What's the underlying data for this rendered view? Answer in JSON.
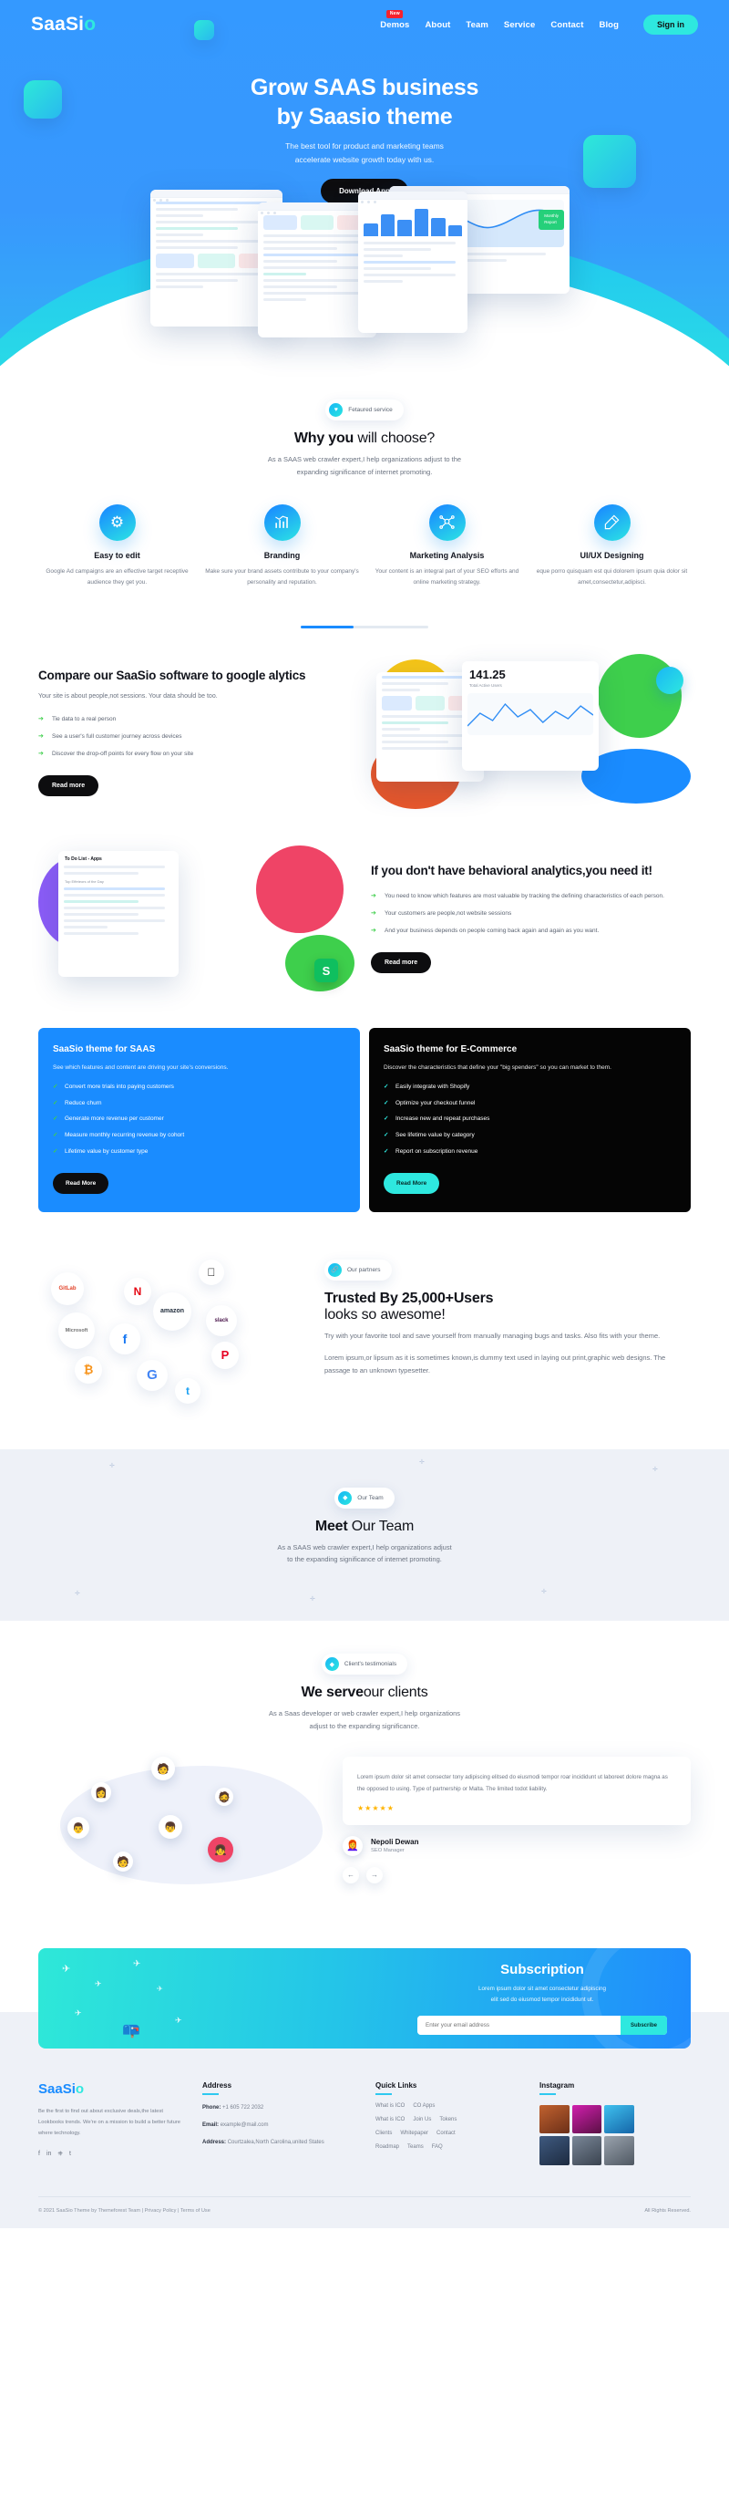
{
  "brand": {
    "name_main": "SaaSi",
    "name_accent": "o"
  },
  "nav": {
    "items": [
      {
        "label": "Demos",
        "badge": "New"
      },
      {
        "label": "About",
        "badge": ""
      },
      {
        "label": "Team",
        "badge": ""
      },
      {
        "label": "Service",
        "badge": ""
      },
      {
        "label": "Contact",
        "badge": ""
      },
      {
        "label": "Blog",
        "badge": ""
      }
    ],
    "signin_label": "Sign in"
  },
  "hero": {
    "title_line1": "Grow SAAS business",
    "title_line2": "by Saasio theme",
    "sub_line1": "The best tool for product and marketing teams",
    "sub_line2": "accelerate website growth today with us.",
    "cta_label": "Download App"
  },
  "why": {
    "pill_icon": "heart-icon",
    "pill_label": "Fetaured service",
    "title_bold": "Why you",
    "title_rest": " will choose?",
    "sub_line1": "As a SAAS web crawler expert,I help organizations adjust to the",
    "sub_line2": "expanding significance of internet promoting.",
    "features": [
      {
        "icon": "gear-icon",
        "glyph": "⚙",
        "title": "Easy to edit",
        "desc": "Google Ad campaigns are an effective target receptive audience they get you."
      },
      {
        "icon": "bar-chart-icon",
        "glyph": "📊",
        "title": "Branding",
        "desc": "Make sure your brand assets contribute to your company's personality and reputation."
      },
      {
        "icon": "network-user-icon",
        "glyph": "🕸",
        "title": "Marketing Analysis",
        "desc": "Your content is an integral part of your SEO efforts and online marketing strategy."
      },
      {
        "icon": "pencil-ruler-icon",
        "glyph": "✎",
        "title": "UI/UX Designing",
        "desc": "eque porro quisquam est qui dolorem ipsum quia dolor sit amet,consectetur,adipisci."
      }
    ]
  },
  "compare": {
    "title": "Compare our SaaSio software to google alytics",
    "lead": "Your site is about people,not sessions. Your data should be too.",
    "bullets": [
      "Tie data to a real person",
      "See a user's full customer journey across devices",
      "Discover the drop-off points for every flow on your site"
    ],
    "cta_label": "Read more",
    "stat_value": "141.25",
    "stat_caption": "Total Active Users"
  },
  "behavioral": {
    "title": "If you don't have behavioral analytics,you need it!",
    "bullets": [
      "You need to know which features are most valuable by tracking the defining characteristics of each person.",
      "Your customers are people,not website sessions",
      "And your business depends on people coming back again and again as you want."
    ],
    "cta_label": "Read more",
    "todo_title": "To Do List - Apps",
    "todo_sub": "Top Effeteors of the Day"
  },
  "panels": [
    {
      "variant": "blue",
      "title": "SaaSio theme for SAAS",
      "desc": "See which features and content are driving your site's conversions.",
      "items": [
        "Convert more trials into paying customers",
        "Reduce churn",
        "Generate more revenue per customer",
        "Measure monthly recurring revenue by cohort",
        "Lifetime value by customer type"
      ],
      "cta_label": "Read More"
    },
    {
      "variant": "black",
      "title": "SaaSio theme for E-Commerce",
      "desc": "Discover the characteristics that define your \"big spenders\" so you can market to them.",
      "items": [
        "Easily integrate with Shopify",
        "Optimize your checkout funnel",
        "Increase new and repeat purchases",
        "See lifetime value by category",
        "Report on subscription revenue"
      ],
      "cta_label": "Read More"
    }
  ],
  "partners": {
    "pill_icon": "link-icon",
    "pill_label": "Our partners",
    "title_bold": "Trusted By 25,000+Users",
    "title_rest": "looks so awesome!",
    "para1": "Try with your favorite tool and save yourself from manually managing bugs and tasks. Also fits with your theme.",
    "para2": "Lorem ipsum,or lipsum as it is sometimes known,is dummy text used in laying out print,graphic web designs. The passage to an unknown typesetter.",
    "logos": [
      {
        "name": "Gitlab",
        "text": "GitLab",
        "color": "#e2432a"
      },
      {
        "name": "Apple",
        "text": "",
        "color": "#111111"
      },
      {
        "name": "Netflix",
        "text": "N",
        "color": "#e50914"
      },
      {
        "name": "Amazon",
        "text": "amazon",
        "color": "#232f3e"
      },
      {
        "name": "Slack",
        "text": "slack",
        "color": "#4a154b"
      },
      {
        "name": "Microsoft",
        "text": "Microsoft",
        "color": "#737373"
      },
      {
        "name": "Facebook",
        "text": "f",
        "color": "#1877f2"
      },
      {
        "name": "Pinterest",
        "text": "P",
        "color": "#e60023"
      },
      {
        "name": "Bitcoin",
        "text": "₿",
        "color": "#f7931a"
      },
      {
        "name": "Google",
        "text": "G",
        "color": "#4285f4"
      },
      {
        "name": "Twitter",
        "text": "t",
        "color": "#1da1f2"
      }
    ]
  },
  "team": {
    "pill_icon": "diamond-icon",
    "pill_label": "Our Team",
    "title_bold": "Meet",
    "title_rest": " Our Team",
    "sub_line1": "As a SAAS web crawler expert,I help organizations adjust",
    "sub_line2": "to the expanding significance of internet promoting."
  },
  "clients": {
    "pill_icon": "diamond-icon",
    "pill_label": "Client's testimonials",
    "title_bold": "We serve",
    "title_rest": "our clients",
    "sub_line1": "As a Saas developer or web crawler expert,I help organizations",
    "sub_line2": "adjust to the expanding significance.",
    "quote": "Lorem ipsum dolor sit amet consecter tony adipiscing elitsed do eiusmodi tempor roar incididunt ut laboreet dolore magna as the opposed to using. Type of partnership or Malta. The limited todot liability.",
    "rating": "★★★★★",
    "author_name": "Nepoli Dewan",
    "author_role": "SEO Manager",
    "prev_label": "←",
    "next_label": "→"
  },
  "subscription": {
    "title": "Subscription",
    "desc_line1": "Lorem ipsum dolor sit amet consectetur adipiscing",
    "desc_line2": "elit sed do eiusmod tempor incididunt ut.",
    "input_placeholder": "Enter your email address",
    "input_value": "",
    "button_label": "Subscribe"
  },
  "footer": {
    "about_text": "Be the first to find out about exclusive deals,the latest Lookbooks trends. We're on a mission to build a better future where technology.",
    "socials": [
      "f",
      "in",
      "⎈",
      "t"
    ],
    "address": {
      "heading": "Address",
      "phone_label": "Phone:",
      "phone_value": "+1 605 722 2032",
      "email_label": "Email:",
      "email_value": "example@mail.com",
      "addr_label": "Address:",
      "addr_value": "Courtzalea,North Carolina,united States"
    },
    "quick": {
      "heading": "Quick Links",
      "rows": [
        [
          "What is ICO",
          "CO Apps"
        ],
        [
          "What is ICO",
          "Join Us",
          "Tokens"
        ],
        [
          "Clients",
          "Whitepaper",
          "Contact"
        ],
        [
          "Roadmap",
          "Teams",
          "FAQ"
        ]
      ]
    },
    "instagram": {
      "heading": "Instagram",
      "tiles": [
        "#8b4a2b",
        "#b81fa0",
        "#1d9fd8",
        "#2f4a6e",
        "#56606e",
        "#7b8493"
      ]
    },
    "copyright": "© 2021 SaaSio Theme by Themeforest Team | Privacy Policy | Terms of Use",
    "rights": "All Rights Reserved."
  }
}
